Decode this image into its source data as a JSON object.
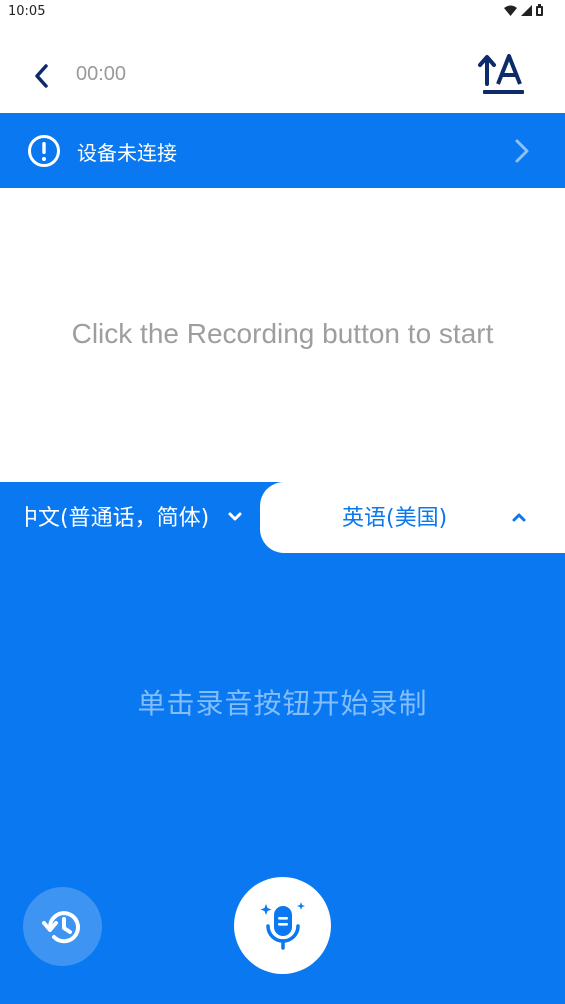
{
  "status_bar": {
    "time": "10:05"
  },
  "header": {
    "timer": "00:00"
  },
  "banner": {
    "text": "设备未连接"
  },
  "content": {
    "hint": "Click the Recording button to start"
  },
  "language": {
    "source": "中文(普通话，简体)",
    "target": "英语(美国)"
  },
  "bottom": {
    "status": "单击录音按钮开始录制"
  },
  "colors": {
    "accent": "#0a78f0",
    "hint_gray": "#9e9e9e",
    "navy": "#0d2a6b"
  },
  "icons": [
    "back-arrow-icon",
    "font-size-icon",
    "alert-icon",
    "chevron-right-icon",
    "chevron-down-icon",
    "chevron-up-icon",
    "history-icon",
    "microphone-icon",
    "wifi-icon",
    "signal-icon",
    "battery-icon"
  ]
}
